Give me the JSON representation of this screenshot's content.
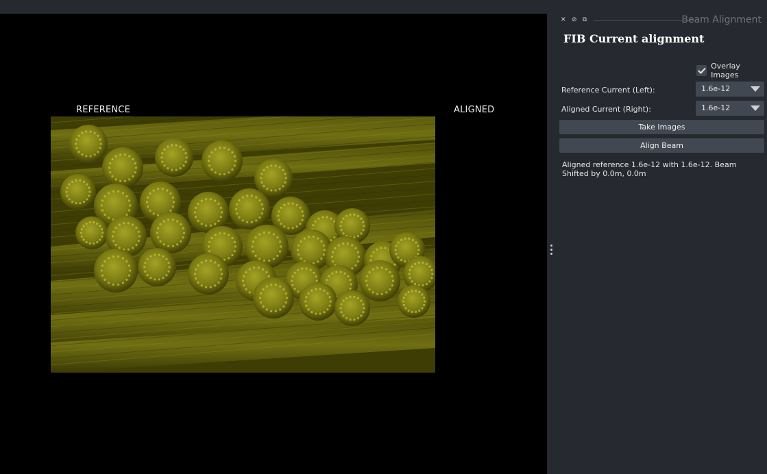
{
  "viewer": {
    "reference_label": "REFERENCE",
    "aligned_label": "ALIGNED",
    "image_tint": "#3e3d04",
    "image_content": "sem-pollen-grains"
  },
  "dock": {
    "title": "Beam Alignment",
    "buttons": [
      "close-icon",
      "float-icon",
      "restore-icon"
    ]
  },
  "panel": {
    "heading": "FIB Current alignment",
    "overlay_label": "Overlay Images",
    "overlay_checked": true,
    "reference_label": "Reference Current (Left):",
    "reference_value": "1.6e-12",
    "aligned_label": "Aligned Current (Right):",
    "aligned_value": "1.6e-12",
    "take_images": "Take Images",
    "align_beam": "Align Beam",
    "status": "Aligned reference 1.6e-12 with 1.6e-12. Beam Shifted by 0.0m, 0.0m"
  },
  "colors": {
    "panel_bg": "#262930",
    "control_bg": "#414851",
    "accent_image": "#8a8a14"
  }
}
